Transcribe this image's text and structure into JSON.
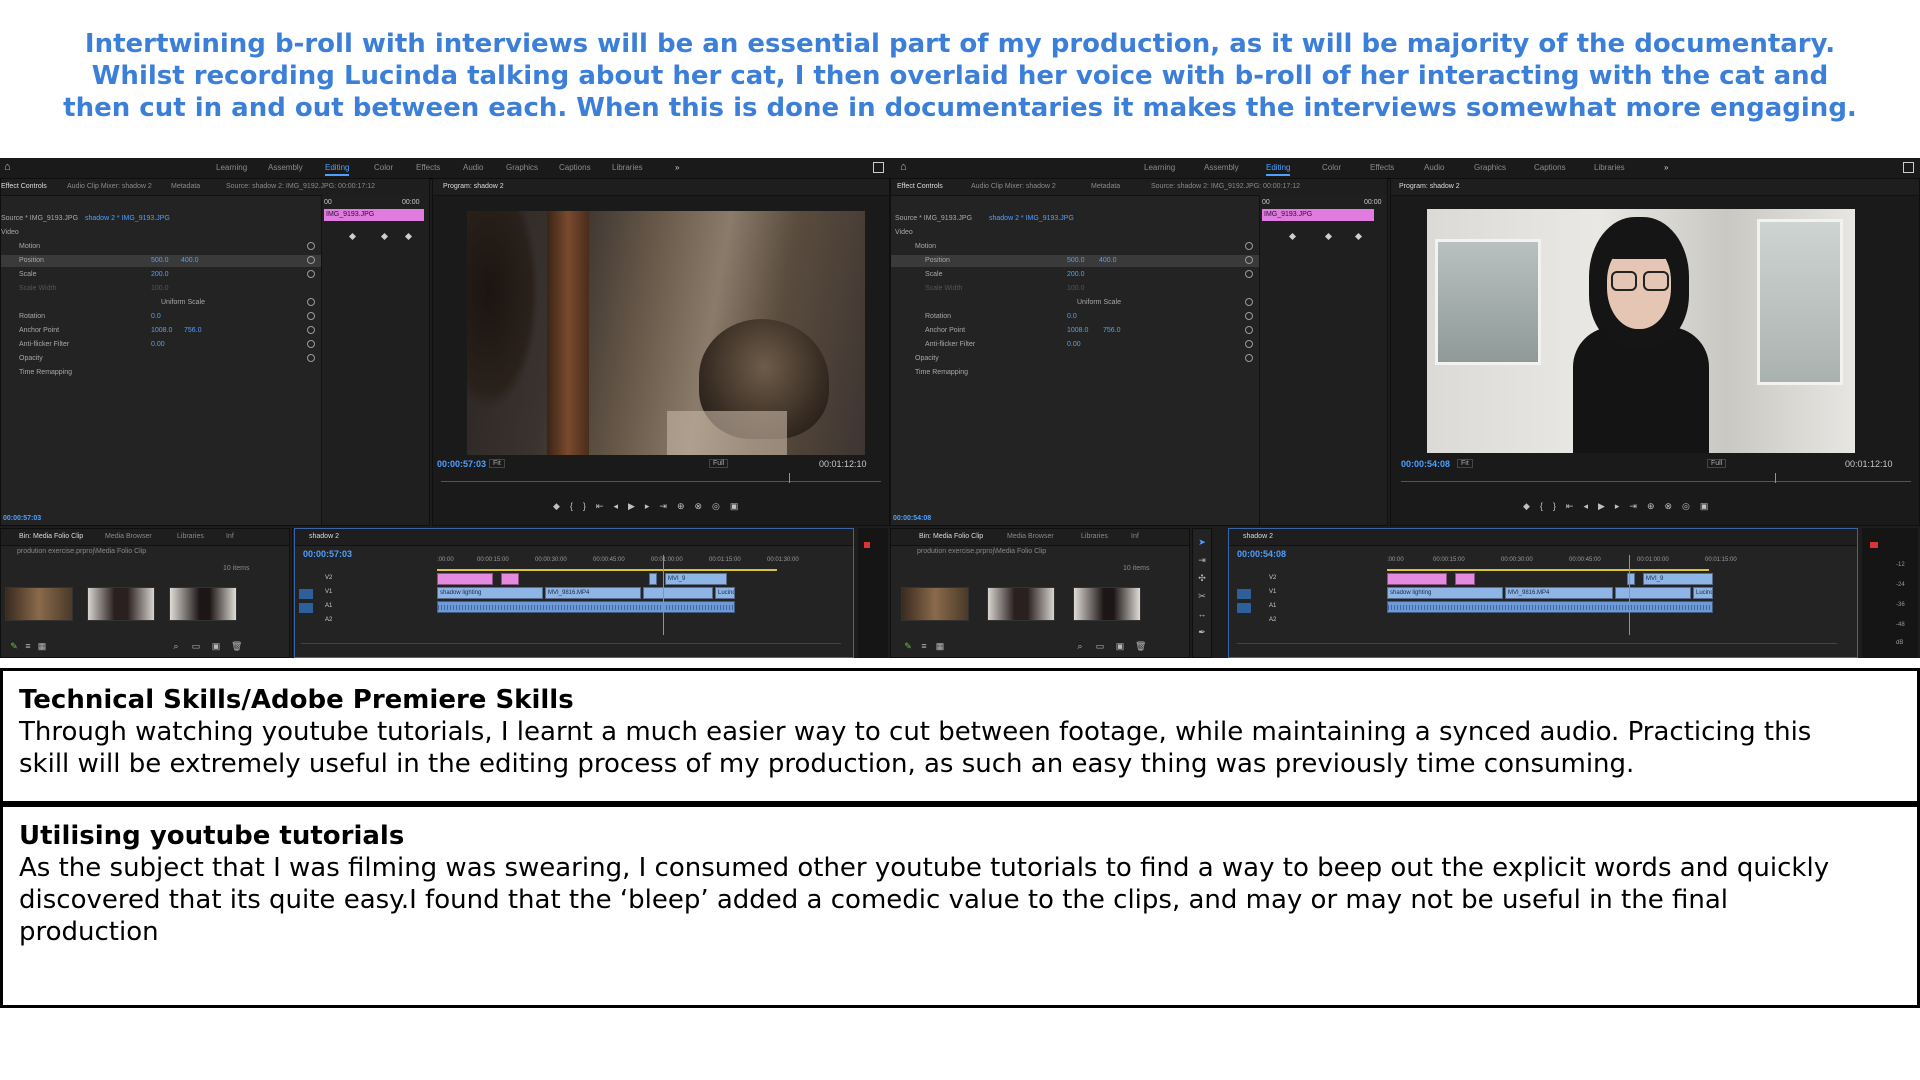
{
  "intro": {
    "lines": [
      "Intertwining b-roll with interviews will be an essential part of my production, as it will be majority of the documentary.",
      "Whilst recording Lucinda talking about her cat, I then overlaid her voice with b-roll of her interacting with the cat and",
      "then cut in and out between each. When this is done in documentaries it makes the interviews somewhat more engaging."
    ]
  },
  "premiere_left": {
    "workspaces": [
      "Learning",
      "Assembly",
      "Editing",
      "Color",
      "Effects",
      "Audio",
      "Graphics",
      "Captions",
      "Libraries"
    ],
    "active_workspace": "Editing",
    "source_tabs": [
      "Effect Controls",
      "Audio Clip Mixer: shadow 2",
      "Metadata",
      "Source: shadow 2: IMG_9192.JPG: 00:00:17:12"
    ],
    "source_line": "Source * IMG_9193.JPG",
    "sequence_line": "shadow 2 * IMG_9193.JPG",
    "video_label": "Video",
    "motion_label": "Motion",
    "position_label": "Position",
    "position_x": "500.0",
    "position_y": "400.0",
    "scale_label": "Scale",
    "scale_value": "200.0",
    "scale_width_label": "Scale Width",
    "scale_width_value": "100.0",
    "uniform_scale_label": "Uniform Scale",
    "rotation_label": "Rotation",
    "rotation_value": "0.0",
    "anchor_label": "Anchor Point",
    "anchor_x": "1008.0",
    "anchor_y": "756.0",
    "antiflicker_label": "Anti-flicker Filter",
    "antiflicker_value": "0.00",
    "opacity_label": "Opacity",
    "time_remap_label": "Time Remapping",
    "clip_name": "IMG_9193.JPG",
    "mini_tc_start": "00",
    "mini_tc_end": "00:00",
    "ec_timecode": "00:00:57:03",
    "program_tab": "Program: shadow 2",
    "program_timecode": "00:00:57:03",
    "fit_label": "Fit",
    "full_label": "Full",
    "program_duration": "00:01:12:10",
    "bin_tabs": [
      "Bin: Media Folio Clip",
      "Media Browser",
      "Libraries",
      "Inf"
    ],
    "bin_path": "prodution exercise.prproj\\Media Folio Clip",
    "items_count": "10 items",
    "timeline_tab": "shadow 2",
    "timeline_timecode": "00:00:57:03",
    "ruler": [
      ":00:00",
      "00:00:15:00",
      "00:00:30:00",
      "00:00:45:00",
      "00:01:00:00",
      "00:01:15:00",
      "00:01:30:00"
    ],
    "track_labels": [
      "V2",
      "V1",
      "A1",
      "A2"
    ],
    "clip_labels": [
      "shadow lighting",
      "MVI_9816.MP4",
      "Lucind",
      "MVI_9"
    ]
  },
  "premiere_right": {
    "workspaces": [
      "Learning",
      "Assembly",
      "Editing",
      "Color",
      "Effects",
      "Audio",
      "Graphics",
      "Captions",
      "Libraries"
    ],
    "active_workspace": "Editing",
    "source_tabs": [
      "Effect Controls",
      "Audio Clip Mixer: shadow 2",
      "Metadata",
      "Source: shadow 2: IMG_9192.JPG: 00:00:17:12"
    ],
    "source_line": "Source * IMG_9193.JPG",
    "sequence_line": "shadow 2 * IMG_9193.JPG",
    "video_label": "Video",
    "motion_label": "Motion",
    "position_label": "Position",
    "position_x": "500.0",
    "position_y": "400.0",
    "scale_label": "Scale",
    "scale_value": "200.0",
    "scale_width_label": "Scale Width",
    "scale_width_value": "100.0",
    "uniform_scale_label": "Uniform Scale",
    "rotation_label": "Rotation",
    "rotation_value": "0.0",
    "anchor_label": "Anchor Point",
    "anchor_x": "1008.0",
    "anchor_y": "756.0",
    "antiflicker_label": "Anti-flicker Filter",
    "antiflicker_value": "0.00",
    "opacity_label": "Opacity",
    "time_remap_label": "Time Remapping",
    "clip_name": "IMG_9193.JPG",
    "mini_tc_start": "00",
    "mini_tc_end": "00:00",
    "ec_timecode": "00:00:54:08",
    "program_tab": "Program: shadow 2",
    "program_timecode": "00:00:54:08",
    "fit_label": "Fit",
    "full_label": "Full",
    "program_duration": "00:01:12:10",
    "bin_tabs": [
      "Bin: Media Folio Clip",
      "Media Browser",
      "Libraries",
      "Inf"
    ],
    "bin_path": "prodution exercise.prproj\\Media Folio Clip",
    "items_count": "10 items",
    "timeline_tab": "shadow 2",
    "timeline_timecode": "00:00:54:08",
    "ruler": [
      ":00:00",
      "00:00:15:00",
      "00:00:30:00",
      "00:00:45:00",
      "00:01:00:00",
      "00:01:15:00"
    ],
    "track_labels": [
      "V2",
      "V1",
      "A1",
      "A2"
    ],
    "clip_labels": [
      "shadow lighting",
      "MVI_9816.MP4",
      "Lucind",
      "MVI_9"
    ],
    "meter_labels": [
      "-12",
      "-24",
      "-36",
      "-48",
      "dB"
    ]
  },
  "section1": {
    "title": "Technical Skills/Adobe Premiere Skills",
    "lines": [
      "Through watching youtube tutorials, I learnt a much easier way to cut between footage, while maintaining a synced audio. Practicing this",
      "skill will be extremely useful in the editing process of my production, as such an easy thing was previously time consuming."
    ]
  },
  "section2": {
    "title": "Utilising youtube tutorials",
    "lines": [
      "As the subject that I was filming was swearing, I consumed other youtube tutorials to find a way to beep out the explicit words and quickly",
      "discovered that its quite easy.I found that the ‘bleep’ added a comedic value to the clips, and may or may not be useful in the final",
      "production"
    ]
  },
  "colors": {
    "intro_text": "#3b7fd9",
    "premiere_bg": "#1d1d1d",
    "accent_blue": "#4ea0ff",
    "clip_pink": "#e07bdf"
  }
}
